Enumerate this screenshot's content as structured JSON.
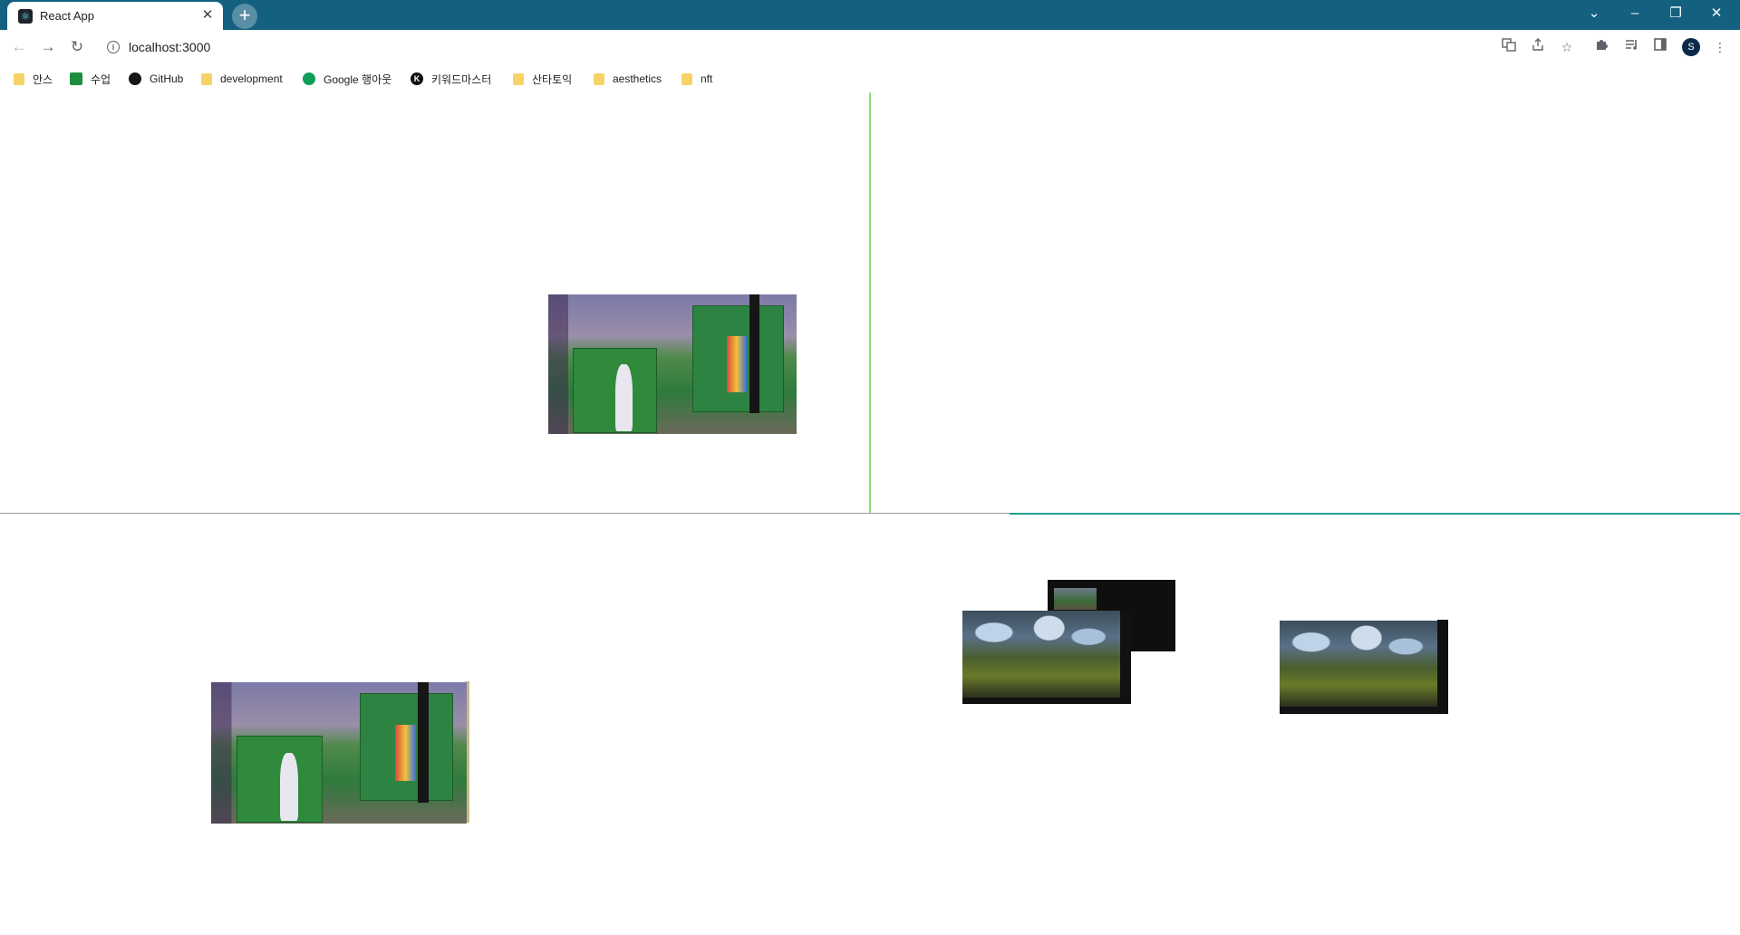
{
  "browser": {
    "tab": {
      "title": "React App"
    },
    "new_tab_label": "+",
    "window_controls": [
      "⌄",
      "–",
      "❐",
      "✕"
    ],
    "nav": {
      "back": "←",
      "forward": "→",
      "reload": "↻"
    },
    "address": {
      "url": "localhost:3000",
      "info_symbol": "i"
    },
    "toolbar_icons": [
      "translate-icon",
      "share-icon",
      "star-icon",
      "extensions-icon",
      "reading-list-icon",
      "sidepanel-icon",
      "menu-icon"
    ],
    "avatar_initial": "S"
  },
  "bookmarks": [
    {
      "label": "안스",
      "type": "folder"
    },
    {
      "label": "수업",
      "type": "classroom"
    },
    {
      "label": "GitHub",
      "type": "github"
    },
    {
      "label": "development",
      "type": "folder"
    },
    {
      "label": "Google 행아웃",
      "type": "hangouts"
    },
    {
      "label": "키워드마스터",
      "type": "keyword"
    },
    {
      "label": "산타토익",
      "type": "folder"
    },
    {
      "label": "aesthetics",
      "type": "folder"
    },
    {
      "label": "nft",
      "type": "folder"
    }
  ],
  "colors": {
    "tabstrip": "#14607f",
    "divider_vertical": "#8de07a",
    "divider_horizontal": "#9a9a9a",
    "divider_horizontal_right": "#1f9e8e"
  }
}
